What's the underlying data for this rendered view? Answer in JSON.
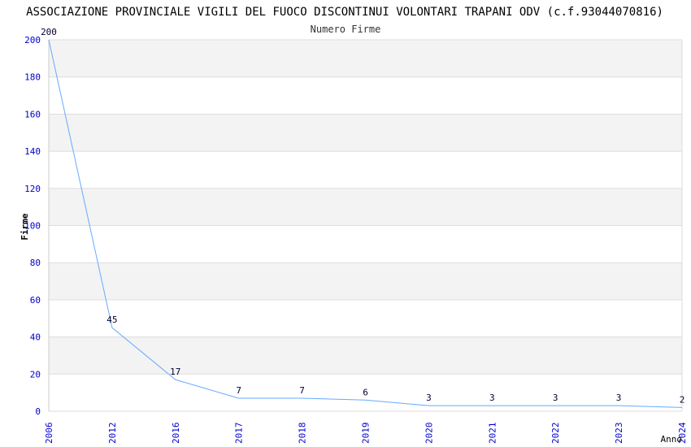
{
  "chart_data": {
    "type": "line",
    "title": "ASSOCIAZIONE PROVINCIALE VIGILI DEL FUOCO DISCONTINUI VOLONTARI TRAPANI ODV (c.f.93044070816)",
    "subtitle": "Numero Firme",
    "xlabel": "Anno",
    "ylabel": "Firme",
    "categories": [
      "2006",
      "2012",
      "2016",
      "2017",
      "2018",
      "2019",
      "2020",
      "2021",
      "2022",
      "2023",
      "2024"
    ],
    "values": [
      200,
      45,
      17,
      7,
      7,
      6,
      3,
      3,
      3,
      3,
      2
    ],
    "ylim": [
      0,
      200
    ],
    "yticks": [
      0,
      20,
      40,
      60,
      80,
      100,
      120,
      140,
      160,
      180,
      200
    ],
    "grid": true,
    "colors": {
      "line": "#66aaff",
      "tick": "#0000cc",
      "band": "#f3f3f3",
      "grid": "#dddddd"
    }
  }
}
